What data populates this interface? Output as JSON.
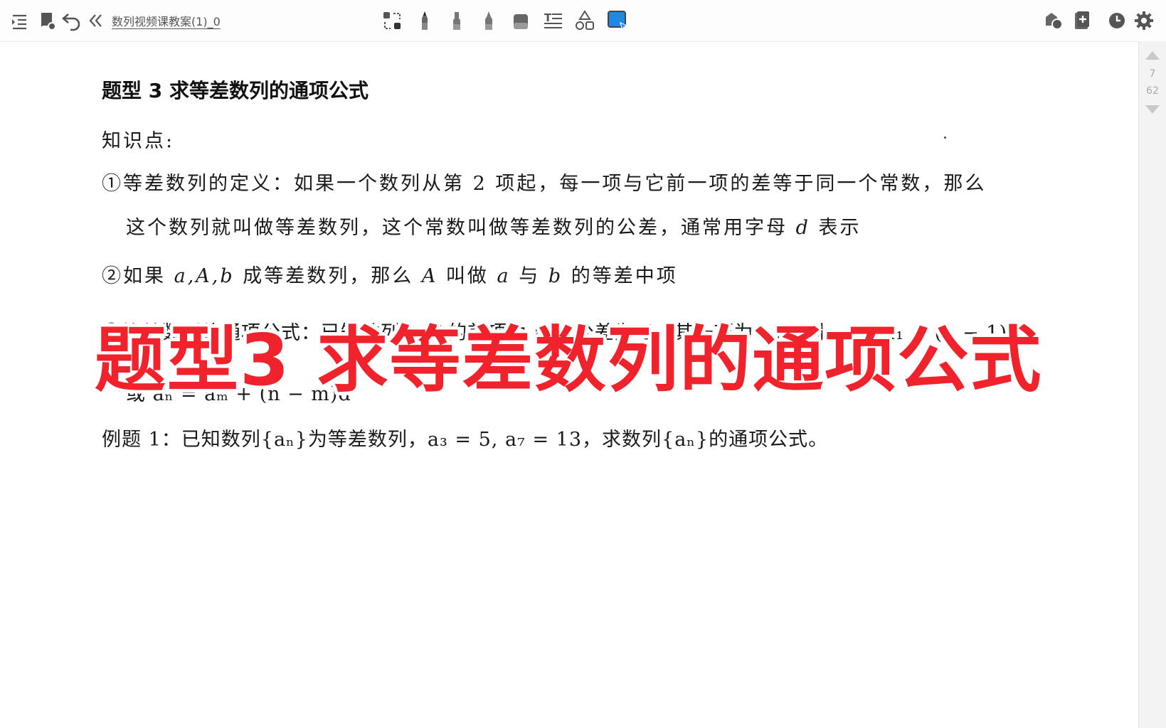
{
  "toolbar": {
    "doc_title": "数列视频课教案(1)_0",
    "left_icons": [
      "outline-icon",
      "notebook-icon",
      "undo-icon",
      "collapse-icon"
    ],
    "tool_icons": [
      "lasso-icon",
      "pen-icon",
      "marker-icon",
      "highlighter-icon",
      "eraser-icon",
      "text-icon",
      "shapes-icon",
      "screenshot-icon"
    ],
    "right_icons": [
      "ink-icon",
      "add-page-icon",
      "history-icon",
      "gear-icon"
    ],
    "active_color": "#1e88e5"
  },
  "pager": {
    "current": "7",
    "total": "62"
  },
  "document": {
    "heading": "题型 3  求等差数列的通项公式",
    "kp_label": "知识点:",
    "p1_line1": "①等差数列的定义：如果一个数列从第 2 项起，每一项与它前一项的差等于同一个常数，那么",
    "p1_line2_pre": "这个数列就叫做等差数列，这个常数叫做等差数列的公差，通常用字母",
    "p1_line2_var": "d",
    "p1_line2_post": "表示",
    "p2_pre": "②如果",
    "p2_vars": "a,A,b",
    "p2_mid": "成等差数列，那么",
    "p2_A": "A",
    "p2_mid2": "叫做",
    "p2_a": "a",
    "p2_mid3": "与",
    "p2_b": "b",
    "p2_post": "的等差中项",
    "p3_line1": "③等差数列的通项公式：已知数列{aₙ}的首项为 a₁，公差为 d，其一项为 aₘ，则 aₙ = a₁ + (n − 1)d",
    "p3_line2": "或 aₙ = aₘ + (n − m)d",
    "example": "例题 1：已知数列{aₙ}为等差数列，a₃ = 5, a₇ = 13，求数列{aₙ}的通项公式。"
  },
  "overlay_caption": "题型3  求等差数列的通项公式",
  "overlay_color": "#f0222c"
}
